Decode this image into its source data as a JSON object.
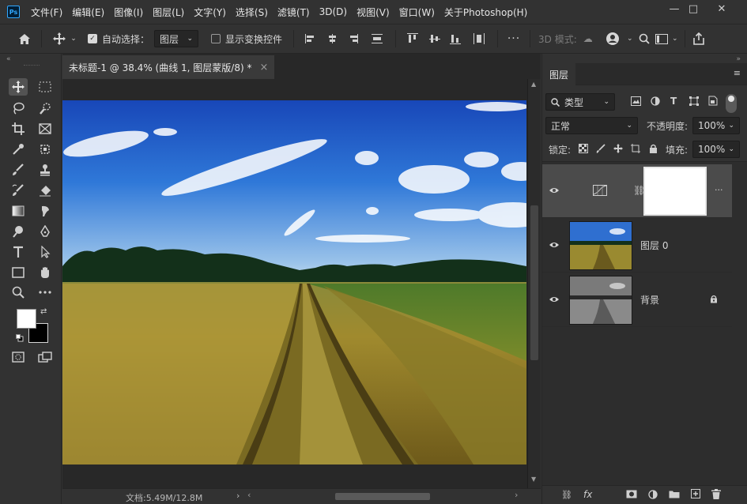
{
  "app": {
    "logo": "Ps"
  },
  "menu": [
    "文件(F)",
    "编辑(E)",
    "图像(I)",
    "图层(L)",
    "文字(Y)",
    "选择(S)",
    "滤镜(T)",
    "3D(D)",
    "视图(V)",
    "窗口(W)",
    "关于Photoshop(H)"
  ],
  "window_controls": {
    "min": "—",
    "max": "□",
    "close": "✕"
  },
  "options": {
    "auto_select_label": "自动选择：",
    "auto_select_checked": true,
    "auto_select_target": "图层",
    "show_transform_label": "显示变换控件",
    "mode_3d_label": "3D 模式:",
    "more": "···"
  },
  "document": {
    "tab_title": "未标题-1 @ 38.4% (曲线 1, 图层蒙版/8) *",
    "close": "×",
    "status": "文档:5.49M/12.8M"
  },
  "layers_panel": {
    "tab": "图层",
    "filter_kind": "类型",
    "blend_mode": "正常",
    "opacity_label": "不透明度:",
    "opacity_value": "100%",
    "lock_label": "锁定:",
    "fill_label": "填充:",
    "fill_value": "100%",
    "layers": [
      {
        "name": "",
        "type": "curves-adjustment",
        "selected": true,
        "visible": true
      },
      {
        "name": "图层 0",
        "type": "image",
        "selected": false,
        "visible": true
      },
      {
        "name": "背景",
        "type": "image-bw",
        "selected": false,
        "visible": true,
        "locked": true
      }
    ]
  },
  "colors": {
    "foreground": "#ffffff",
    "background": "#000000",
    "accent": "#31a8ff"
  }
}
